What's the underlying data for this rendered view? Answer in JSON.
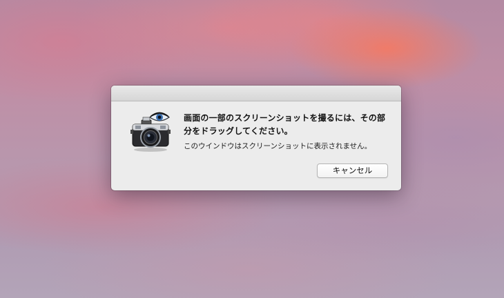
{
  "dialog": {
    "message": "画面の一部のスクリーンショットを撮るには、その部分をドラッグしてください。",
    "informative": "このウインドウはスクリーンショットに表示されません。",
    "cancel_label": "キャンセル",
    "icon": "camera-with-eye-icon"
  },
  "colors": {
    "dialog_bg": "#ececec",
    "button_bg": "#ffffff",
    "text": "#111111"
  }
}
